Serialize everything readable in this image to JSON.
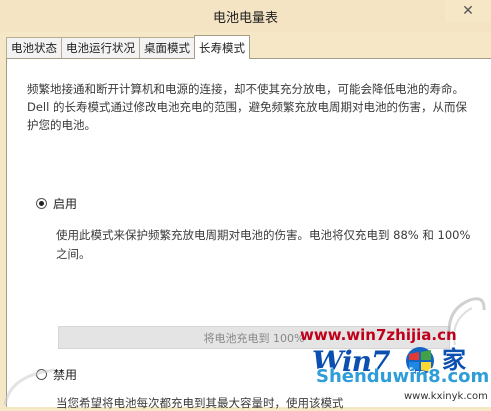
{
  "window": {
    "title": "电池电量表",
    "close_glyph": "✕"
  },
  "tabs": [
    {
      "label": "电池状态"
    },
    {
      "label": "电池运行状况"
    },
    {
      "label": "桌面模式"
    },
    {
      "label": "长寿模式",
      "active": true
    }
  ],
  "description": "频繁地接通和断开计算机和电源的连接，却不使其充分放电，可能会降低电池的寿命。Dell 的长寿模式通过修改电池充电的范围，避免频繁充放电周期对电池的伤害，从而保护您的电池。",
  "enable_option": {
    "label": "启用",
    "checked": true,
    "description": "使用此模式来保护频繁充放电周期对电池的伤害。电池将仅充电到 88% 和 100% 之间。"
  },
  "slider": {
    "label": "将电池充电到 100%",
    "percent": 100
  },
  "disable_option": {
    "label": "禁用",
    "checked": false,
    "description": "当您希望将电池每次都充电到其最大容量时，使用该模式"
  },
  "watermark": {
    "url": "www.win7zhijia.cn",
    "logo_text": "Win7",
    "logo_suffix": "家",
    "brand": "Shenduwin8.com",
    "site": "www.kxinyk.com"
  },
  "colors": {
    "title_bg": "#f4e4c3",
    "panel_bg": "#ffffff",
    "watermark_red": "#c0001a",
    "watermark_blue": "#0b4fb0"
  }
}
